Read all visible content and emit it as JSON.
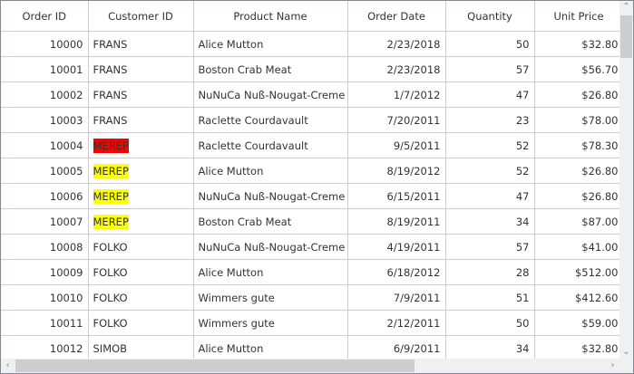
{
  "columns": [
    "Order ID",
    "Customer ID",
    "Product Name",
    "Order Date",
    "Quantity",
    "Unit Price"
  ],
  "rows": [
    {
      "order_id": "10000",
      "customer_id": "FRANS",
      "product": "Alice Mutton",
      "date": "2/23/2018",
      "qty": "50",
      "price": "$32.80",
      "highlight": ""
    },
    {
      "order_id": "10001",
      "customer_id": "FRANS",
      "product": "Boston Crab Meat",
      "date": "2/23/2018",
      "qty": "57",
      "price": "$56.70",
      "highlight": ""
    },
    {
      "order_id": "10002",
      "customer_id": "FRANS",
      "product": "NuNuCa Nuß-Nougat-Creme",
      "date": "1/7/2012",
      "qty": "47",
      "price": "$26.80",
      "highlight": ""
    },
    {
      "order_id": "10003",
      "customer_id": "FRANS",
      "product": "Raclette Courdavault",
      "date": "7/20/2011",
      "qty": "23",
      "price": "$78.00",
      "highlight": ""
    },
    {
      "order_id": "10004",
      "customer_id": "MEREP",
      "product": "Raclette Courdavault",
      "date": "9/5/2011",
      "qty": "52",
      "price": "$78.30",
      "highlight": "#ff0000"
    },
    {
      "order_id": "10005",
      "customer_id": "MEREP",
      "product": "Alice Mutton",
      "date": "8/19/2012",
      "qty": "52",
      "price": "$26.80",
      "highlight": "#ffff00"
    },
    {
      "order_id": "10006",
      "customer_id": "MEREP",
      "product": "NuNuCa Nuß-Nougat-Creme",
      "date": "6/15/2011",
      "qty": "47",
      "price": "$26.80",
      "highlight": "#ffff00"
    },
    {
      "order_id": "10007",
      "customer_id": "MEREP",
      "product": "Boston Crab Meat",
      "date": "8/19/2011",
      "qty": "34",
      "price": "$87.00",
      "highlight": "#ffff00"
    },
    {
      "order_id": "10008",
      "customer_id": "FOLKO",
      "product": "NuNuCa Nuß-Nougat-Creme",
      "date": "4/19/2011",
      "qty": "57",
      "price": "$41.00",
      "highlight": ""
    },
    {
      "order_id": "10009",
      "customer_id": "FOLKO",
      "product": "Alice Mutton",
      "date": "6/18/2012",
      "qty": "28",
      "price": "$512.00",
      "highlight": ""
    },
    {
      "order_id": "10010",
      "customer_id": "FOLKO",
      "product": "Wimmers gute",
      "date": "7/9/2011",
      "qty": "51",
      "price": "$412.60",
      "highlight": ""
    },
    {
      "order_id": "10011",
      "customer_id": "FOLKO",
      "product": "Wimmers gute",
      "date": "2/12/2011",
      "qty": "50",
      "price": "$59.00",
      "highlight": ""
    },
    {
      "order_id": "10012",
      "customer_id": "SIMOB",
      "product": "Alice Mutton",
      "date": "6/9/2011",
      "qty": "34",
      "price": "$32.80",
      "highlight": ""
    }
  ],
  "icons": {
    "scroll_up": "chevron-up-icon",
    "scroll_down": "chevron-down-icon",
    "scroll_left": "chevron-left-icon",
    "scroll_right": "chevron-right-icon"
  }
}
